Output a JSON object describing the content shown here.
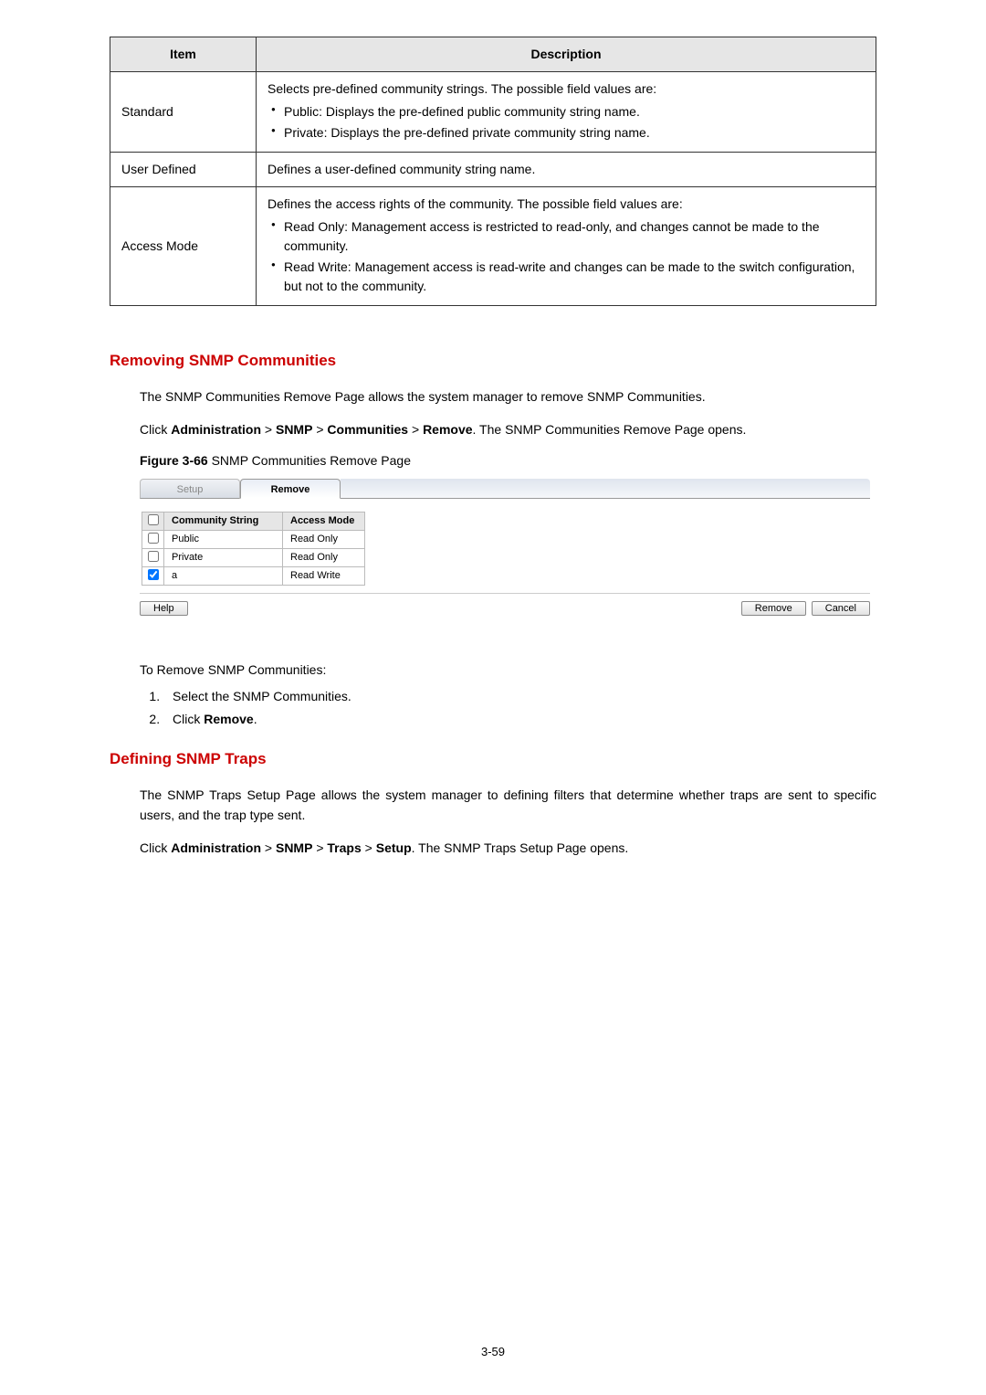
{
  "table1": {
    "headers": {
      "item": "Item",
      "desc": "Description"
    },
    "rows": [
      {
        "item": "Standard",
        "desc_intro": "Selects pre-defined community strings. The possible field values are:",
        "bullets": [
          "Public: Displays the pre-defined public community string name.",
          "Private: Displays the pre-defined private community string name."
        ]
      },
      {
        "item": "User Defined",
        "desc_intro": "Defines a user-defined community string name.",
        "bullets": []
      },
      {
        "item": "Access Mode",
        "desc_intro": "Defines the access rights of the community. The possible field values are:",
        "bullets": [
          "Read Only: Management access is restricted to read-only, and changes cannot be made to the community.",
          "Read Write: Management access is read-write and changes can be made to the switch configuration, but not to the community."
        ]
      }
    ]
  },
  "section1": {
    "title": "Removing SNMP Communities",
    "p1": "The SNMP Communities Remove Page allows the system manager to remove SNMP Communities.",
    "p2_pre": "Click ",
    "p2_b1": "Administration",
    "p2_gt": " > ",
    "p2_b2": "SNMP",
    "p2_b3": "Communities",
    "p2_b4": "Remove",
    "p2_post": ". The SNMP Communities Remove Page opens.",
    "caption_b": "Figure 3-66",
    "caption_rest": " SNMP Communities Remove Page"
  },
  "ui": {
    "tabs": {
      "setup": "Setup",
      "remove": "Remove"
    },
    "headers": {
      "cb": "",
      "cs": "Community String",
      "am": "Access Mode"
    },
    "rows": [
      {
        "checked": false,
        "cs": "Public",
        "am": "Read Only"
      },
      {
        "checked": false,
        "cs": "Private",
        "am": "Read Only"
      },
      {
        "checked": true,
        "cs": "a",
        "am": "Read Write"
      }
    ],
    "buttons": {
      "help": "Help",
      "remove": "Remove",
      "cancel": "Cancel"
    }
  },
  "steps": {
    "intro": "To Remove SNMP Communities:",
    "s1": "Select the SNMP Communities.",
    "s2_pre": "Click ",
    "s2_b": "Remove",
    "s2_post": "."
  },
  "section2": {
    "title": "Defining SNMP Traps",
    "p1": "The SNMP Traps Setup Page allows the system manager to defining filters that determine whether traps are sent to specific users, and the trap type sent.",
    "p2_pre": "Click ",
    "p2_b1": "Administration",
    "p2_gt": " > ",
    "p2_b2": "SNMP",
    "p2_b3": "Traps",
    "p2_b4": "Setup",
    "p2_post": ". The SNMP Traps Setup Page opens."
  },
  "pagenum": "3-59"
}
